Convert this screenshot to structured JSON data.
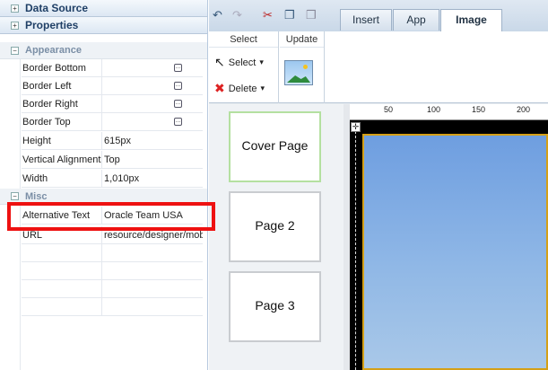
{
  "left_panel": {
    "accordion": [
      {
        "label": "Data Source",
        "toggle": "+"
      },
      {
        "label": "Properties",
        "toggle": "+"
      }
    ],
    "sections": {
      "appearance": {
        "label": "Appearance",
        "toggle": "−"
      },
      "misc": {
        "label": "Misc",
        "toggle": "−"
      }
    },
    "properties": [
      {
        "key": "Border Bottom",
        "value": ""
      },
      {
        "key": "Border Left",
        "value": ""
      },
      {
        "key": "Border Right",
        "value": ""
      },
      {
        "key": "Border Top",
        "value": ""
      },
      {
        "key": "Height",
        "value": "615px"
      },
      {
        "key": "Vertical Alignment",
        "value": "Top"
      },
      {
        "key": "Width",
        "value": "1,010px"
      }
    ],
    "misc_properties": [
      {
        "key": "Alternative Text",
        "value": "Oracle Team USA"
      },
      {
        "key": "URL",
        "value": "resource/designer/mob"
      }
    ],
    "dots_glyph": "…"
  },
  "toolbar": {
    "icons": [
      "undo-icon",
      "redo-icon",
      "cut-icon",
      "copy-icon",
      "paste-icon"
    ],
    "undo_glyph": "↶",
    "redo_glyph": "↷",
    "cut_glyph": "✂",
    "copy_glyph": "❐",
    "paste_glyph": "❒",
    "tabs": [
      {
        "label": "Insert",
        "active": false
      },
      {
        "label": "App",
        "active": false
      },
      {
        "label": "Image",
        "active": true
      }
    ]
  },
  "ribbon": {
    "select_group": {
      "title": "Select",
      "select_label": "Select",
      "delete_label": "Delete"
    },
    "update_group": {
      "title": "Update"
    },
    "cursor_glyph": "↖",
    "delete_glyph": "✖",
    "dropdown_glyph": "▾"
  },
  "pages": [
    {
      "label": "Cover Page",
      "selected": true
    },
    {
      "label": "Page 2",
      "selected": false
    },
    {
      "label": "Page 3",
      "selected": false
    }
  ],
  "ruler": {
    "ticks": [
      "50",
      "100",
      "150",
      "200"
    ]
  },
  "anchor_glyph": "✛",
  "colors": {
    "highlight": "#e11111",
    "selected_thumb_border": "#b4e0a0",
    "image_border": "#d4a017"
  }
}
